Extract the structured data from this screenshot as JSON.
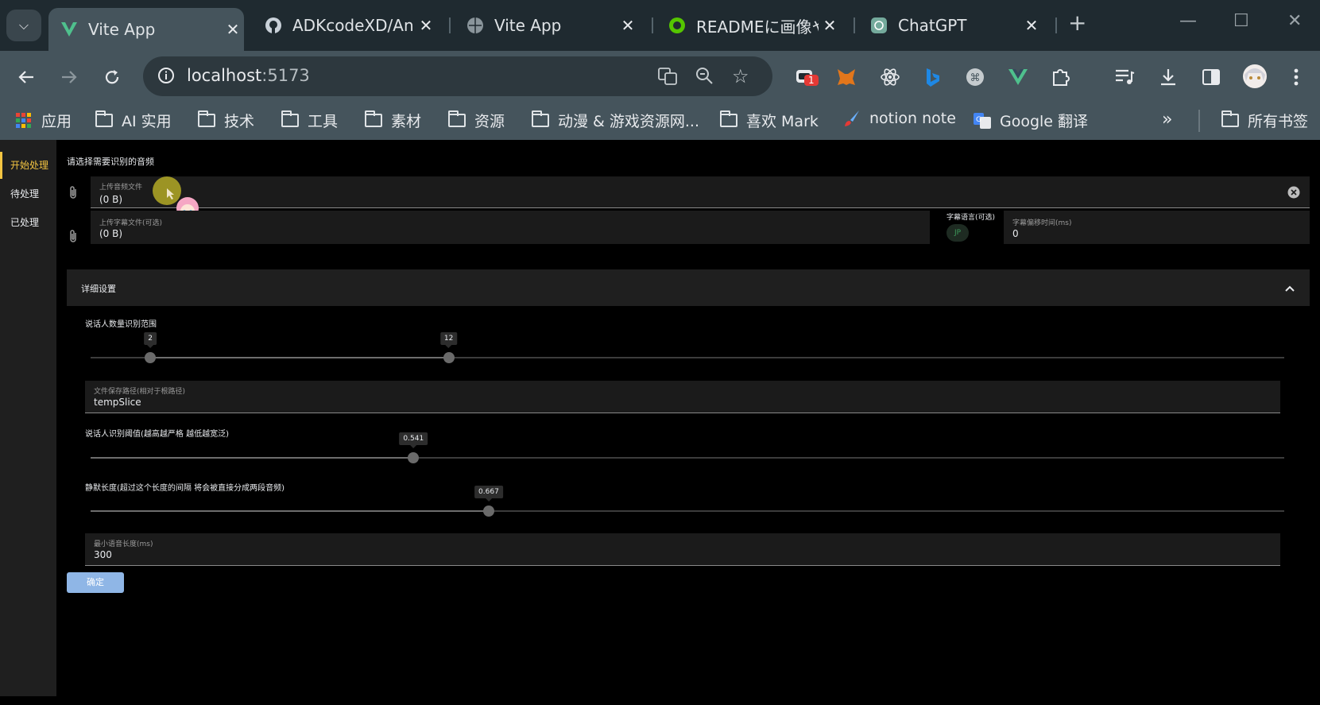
{
  "browser": {
    "tabs": [
      {
        "title": "Vite App",
        "favicon": "vite-icon",
        "active": true
      },
      {
        "title": "ADKcodeXD/Anir",
        "favicon": "github-icon",
        "active": false
      },
      {
        "title": "Vite App",
        "favicon": "globe-icon",
        "active": false
      },
      {
        "title": "READMEに画像や",
        "favicon": "qiita-icon",
        "active": false
      },
      {
        "title": "ChatGPT",
        "favicon": "chatgpt-icon",
        "active": false
      }
    ],
    "url_host": "localhost",
    "url_port": ":5173",
    "extension_badge": "1",
    "bookmarks": [
      {
        "label": "应用",
        "icon": "apps-grid-icon"
      },
      {
        "label": "AI 实用",
        "icon": "folder-icon"
      },
      {
        "label": "技术",
        "icon": "folder-icon"
      },
      {
        "label": "工具",
        "icon": "folder-icon"
      },
      {
        "label": "素材",
        "icon": "folder-icon"
      },
      {
        "label": "资源",
        "icon": "folder-icon"
      },
      {
        "label": "动漫 & 游戏资源网...",
        "icon": "folder-icon"
      },
      {
        "label": "喜欢 Mark",
        "icon": "folder-icon"
      },
      {
        "label": "notion note",
        "icon": "brush-icon"
      },
      {
        "label": "Google 翻译",
        "icon": "translate-icon"
      }
    ],
    "all_bookmarks": "所有书签"
  },
  "sidebar": {
    "items": [
      {
        "label": "开始处理",
        "active": true
      },
      {
        "label": "待处理",
        "active": false
      },
      {
        "label": "已处理",
        "active": false
      }
    ]
  },
  "form": {
    "section_title": "请选择需要识别的音频",
    "audio_upload": {
      "label": "上传音频文件",
      "value": "(0 B)"
    },
    "subtitle_upload": {
      "label": "上传字幕文件(可选)",
      "value": "(0 B)"
    },
    "subtitle_lang": {
      "label": "字幕语言(可选)",
      "value": "JP"
    },
    "subtitle_offset": {
      "label": "字幕偏移时间(ms)",
      "value": "0"
    },
    "details_title": "详细设置",
    "speaker_range": {
      "label": "说话人数量识别范围",
      "min": 2,
      "max": 12,
      "range_min": 0,
      "range_max": 40
    },
    "save_path": {
      "label": "文件保存路径(相对于根路径)",
      "value": "tempSlice"
    },
    "speaker_threshold": {
      "label": "说话人识别阈值(越高越严格 越低越宽泛)",
      "value": 0.541
    },
    "silence_length": {
      "label": "静默长度(超过这个长度的间隔 将会被直接分成两段音频)",
      "value": 0.667
    },
    "min_speech": {
      "label": "最小语音长度(ms)",
      "value": "300"
    },
    "confirm_label": "确定"
  }
}
